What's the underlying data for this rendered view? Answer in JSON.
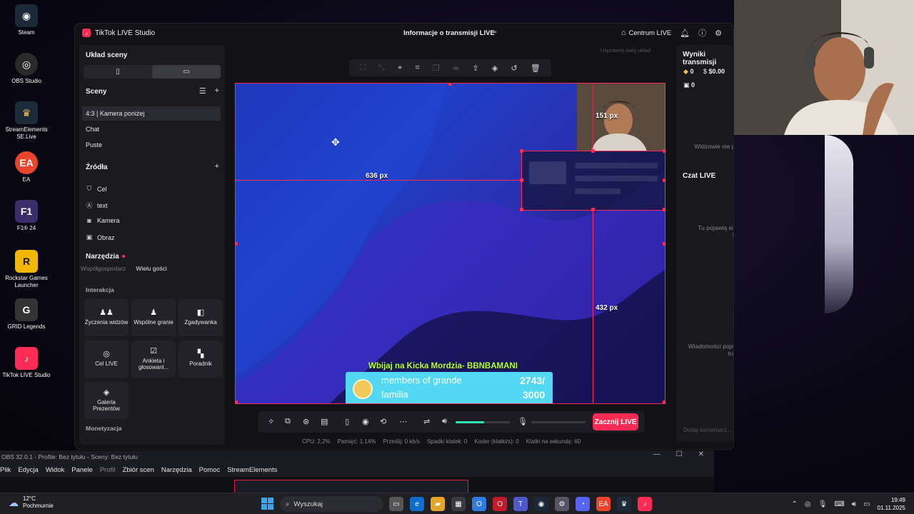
{
  "desktop": {
    "icons": [
      {
        "label": "Steam",
        "icon": "steam-icon",
        "glyph": "◉",
        "color": "#1b2838"
      },
      {
        "label": "OBS Studio",
        "icon": "obs-icon",
        "glyph": "◎",
        "color": "#2a2a2a"
      },
      {
        "label": "StreamElements SE.Live",
        "icon": "streamelements-icon",
        "glyph": "♛",
        "color": "#1c2a3a"
      },
      {
        "label": "EA",
        "icon": "ea-icon",
        "glyph": "EA",
        "color": "#e8452c"
      },
      {
        "label": "F1® 24",
        "icon": "f1-icon",
        "glyph": "F1",
        "color": "#3a2d6a"
      },
      {
        "label": "Rockstar Games Launcher",
        "icon": "rockstar-icon",
        "glyph": "R",
        "color": "#f2b705"
      },
      {
        "label": "GRID Legends",
        "icon": "grid-legends-icon",
        "glyph": "G",
        "color": "#333"
      },
      {
        "label": "TikTok LIVE Studio",
        "icon": "tiktok-icon",
        "glyph": "♪",
        "color": "#fe2c55"
      }
    ]
  },
  "app": {
    "title": "TikTok LIVE Studio",
    "center_title": "Informacje o transmisji LIVE",
    "centrum": "Centrum LIVE"
  },
  "left": {
    "layout_title": "Układ sceny",
    "scenes_title": "Sceny",
    "scenes": [
      "4:3 | Kamera poniżej",
      "Chat",
      "Puste"
    ],
    "sources_title": "Źródła",
    "sources": [
      {
        "label": "Cel",
        "icon": "shield-icon",
        "glyph": "⛉"
      },
      {
        "label": "text",
        "icon": "text-icon",
        "glyph": "A"
      },
      {
        "label": "Kamera",
        "icon": "camera-icon",
        "glyph": "◙"
      },
      {
        "label": "Obraz",
        "icon": "image-icon",
        "glyph": "▣"
      }
    ],
    "tools_title": "Narzędzia",
    "subtabs": [
      "Współgospodarz",
      "Wielu gości"
    ],
    "interaction_title": "Interakcja",
    "tools": [
      {
        "label": "Życzenia widzów",
        "icon": "viewers-wishes-icon",
        "glyph": "👥"
      },
      {
        "label": "Wspólne granie",
        "icon": "joint-play-icon",
        "glyph": "♟"
      },
      {
        "label": "Zgadywanka",
        "icon": "guess-icon",
        "glyph": "◧"
      },
      {
        "label": "Cel LIVE",
        "icon": "live-goal-icon",
        "glyph": "◎"
      },
      {
        "label": "Ankieta i głosowanl...",
        "icon": "poll-icon",
        "glyph": "☑"
      },
      {
        "label": "Poradnik",
        "icon": "guide-icon",
        "glyph": "📖"
      },
      {
        "label": "Galeria Prezentów",
        "icon": "gift-gallery-icon",
        "glyph": "◈"
      }
    ],
    "monetization_title": "Monetyzacja"
  },
  "canvas": {
    "hint": "Usprawnij swój układ",
    "measure_width": "636 px",
    "measure_cam": "151 px",
    "measure_height": "432 px",
    "kick_text": "Wbijaj na Kicka Mordzia- BBNBAMANI",
    "goal_line1": "members of grande",
    "goal_line2": "familia",
    "goal_current": "2743/",
    "goal_target": "3000",
    "volume_level": 0.52
  },
  "controls": {
    "start_live": "Zacznij LIVE"
  },
  "stats": {
    "cpu": "CPU: 2,2%",
    "memory": "Pamięć: 1.14%",
    "bitrate": "Prześlij: 0 kb/s",
    "dropped": "Spadki klatek: 0",
    "encoder": "Koder (klatki/s): 0",
    "fps": "Klatki na sekundę: 60"
  },
  "right": {
    "results_title": "Wyniki transmisji",
    "diamonds": "0",
    "dollars": "$0.00",
    "gifts": "0",
    "no_viewers": "Widzowie nie pojawili się jeszcze online",
    "chat_title": "Czat LIVE",
    "gifts_info": "Tu pojawią się Prezenty i subskrypcje Superfanów",
    "messages_info": "Wiadomości pojawią się tutaj po rozpoczęciu transmisji LIVE",
    "chat_placeholder": "Dodaj komentarz..."
  },
  "obs": {
    "title": "OBS 32.0.1 - Profile: Bez tytułu - Sceny: Bez tytułu",
    "menu": [
      "Plik",
      "Edycja",
      "Widok",
      "Panele",
      "Profil",
      "Zbiór scen",
      "Narzędzia",
      "Pomoc",
      "StreamElements"
    ]
  },
  "taskbar": {
    "temp": "12°C",
    "weather": "Pochmurnie",
    "search": "Wyszukaj",
    "time": "19:49",
    "date": "01.11.2025"
  },
  "colors": {
    "accent": "#fe2c55",
    "volume": "#33e6b0",
    "kick": "#b7ff3a",
    "goal_bar": "#52d8f2"
  }
}
